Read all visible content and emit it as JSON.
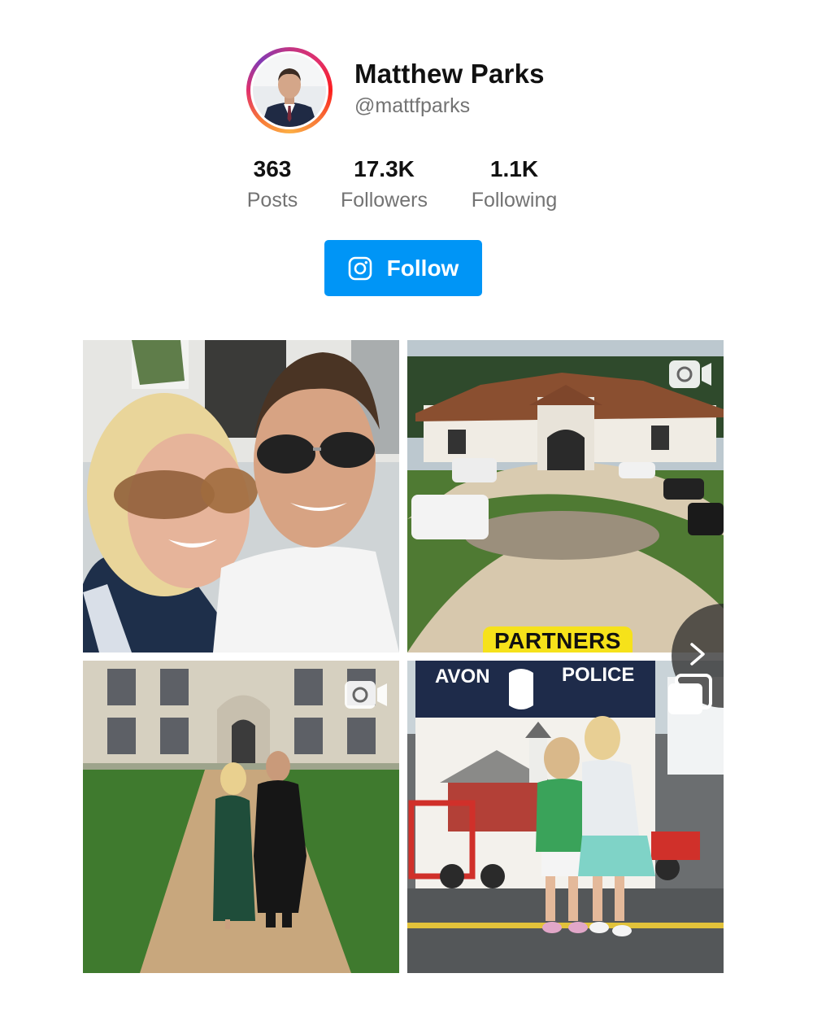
{
  "profile": {
    "name": "Matthew Parks",
    "handle": "@mattfparks",
    "avatar_icon": "profile-photo"
  },
  "stats": {
    "posts": {
      "value": "363",
      "label": "Posts"
    },
    "followers": {
      "value": "17.3K",
      "label": "Followers"
    },
    "following": {
      "value": "1.1K",
      "label": "Following"
    }
  },
  "follow_button": {
    "label": "Follow",
    "icon": "instagram-icon",
    "color": "#0095f6"
  },
  "posts": [
    {
      "type": "photo",
      "subject": "selfie"
    },
    {
      "type": "video",
      "badge_text": "PARTNERS",
      "icons": [
        "video-icon"
      ]
    },
    {
      "type": "video",
      "icons": [
        "video-icon"
      ]
    },
    {
      "type": "carousel",
      "sign_left": "AVON",
      "sign_right": "POLICE",
      "icons": [
        "carousel-icon"
      ]
    }
  ],
  "colors": {
    "accent": "#0095f6",
    "text_secondary": "#737373",
    "partners_badge": "#f6e21a"
  }
}
